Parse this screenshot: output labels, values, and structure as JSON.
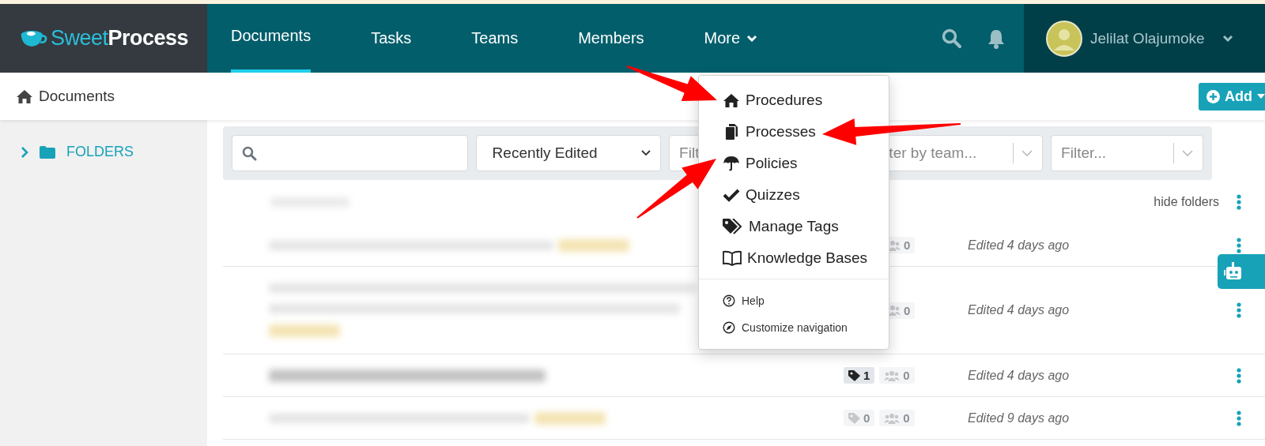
{
  "top_bar": {
    "logo": {
      "light": "Sweet",
      "bold": "Process"
    },
    "nav": [
      {
        "label": "Documents",
        "selected": true
      },
      {
        "label": "Tasks",
        "selected": false
      },
      {
        "label": "Teams",
        "selected": false
      },
      {
        "label": "Members",
        "selected": false
      }
    ],
    "more": "More",
    "user": {
      "name": "Jelilat Olajumoke"
    }
  },
  "breadcrumb": "Documents",
  "add_button": "Add",
  "sidebar": {
    "items": [
      {
        "label": "FOLDERS",
        "expanded": false
      }
    ]
  },
  "filters": [
    {
      "kind": "select",
      "value": "Recently Edited"
    },
    {
      "kind": "select",
      "placeholder": "Filt"
    },
    {
      "kind": "multi",
      "placeholder": "ter by team..."
    },
    {
      "kind": "multi",
      "placeholder": "Filter..."
    }
  ],
  "list": {
    "hide_folders": "hide folders",
    "rows": [
      {
        "kind": "single",
        "members": "0",
        "edited": "Edited 4 days ago"
      },
      {
        "kind": "double",
        "members": "0",
        "edited": "Edited 4 days ago"
      },
      {
        "kind": "bold",
        "tags": "1",
        "tags_active": true,
        "members": "0",
        "edited": "Edited 4 days ago"
      },
      {
        "kind": "single",
        "tags": "0",
        "tags_active": false,
        "members": "0",
        "edited": "Edited 9 days ago"
      }
    ]
  },
  "more_menu": {
    "items": [
      {
        "kind": "home",
        "label": "Procedures"
      },
      {
        "kind": "copy",
        "label": "Processes"
      },
      {
        "kind": "umbrella",
        "label": "Policies"
      },
      {
        "kind": "check",
        "label": "Quizzes"
      },
      {
        "kind": "tags",
        "label": "Manage Tags"
      },
      {
        "kind": "book",
        "label": "Knowledge Bases"
      }
    ],
    "footer": [
      {
        "kind": "help",
        "label": "Help"
      },
      {
        "kind": "compass",
        "label": "Customize navigation"
      }
    ]
  }
}
